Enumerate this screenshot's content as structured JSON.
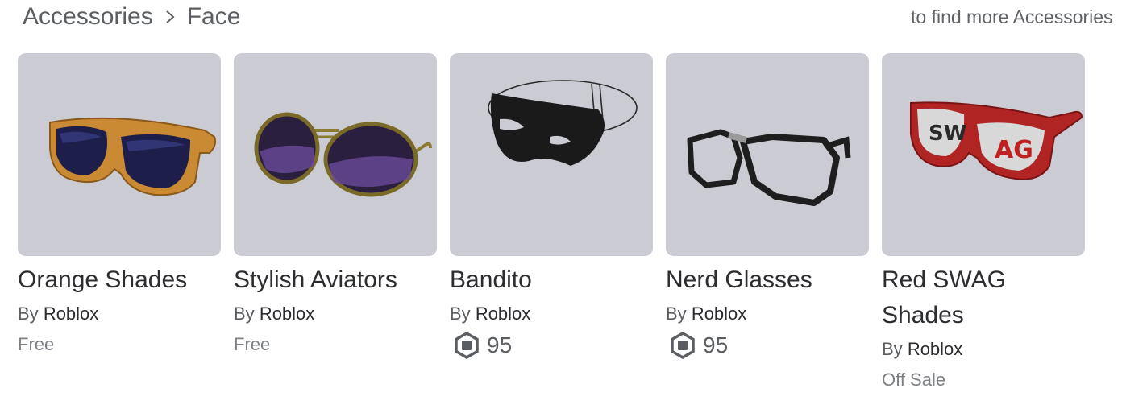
{
  "breadcrumb": {
    "parent": "Accessories",
    "current": "Face"
  },
  "hint": {
    "line1": "to find more Accessories"
  },
  "items": [
    {
      "name": "Orange Shades",
      "by_label": "By",
      "creator": "Roblox",
      "price_text": "Free",
      "price_type": "text",
      "image_icon": "orange-shades-image"
    },
    {
      "name": "Stylish Aviators",
      "by_label": "By",
      "creator": "Roblox",
      "price_text": "Free",
      "price_type": "text",
      "image_icon": "stylish-aviators-image"
    },
    {
      "name": "Bandito",
      "by_label": "By",
      "creator": "Roblox",
      "price_text": "95",
      "price_type": "robux",
      "image_icon": "bandito-image"
    },
    {
      "name": "Nerd Glasses",
      "by_label": "By",
      "creator": "Roblox",
      "price_text": "95",
      "price_type": "robux",
      "image_icon": "nerd-glasses-image"
    },
    {
      "name": "Red SWAG Shades",
      "by_label": "By",
      "creator": "Roblox",
      "price_text": "Off Sale",
      "price_type": "text",
      "image_icon": "red-swag-shades-image"
    }
  ],
  "colors": {
    "thumb_bg": "#cbccd3",
    "text_primary": "#2b2d30",
    "text_secondary": "#5a5d61",
    "text_muted": "#7d8085"
  },
  "icons": {
    "breadcrumb_separator": "chevron-right-icon",
    "currency": "robux-icon"
  }
}
